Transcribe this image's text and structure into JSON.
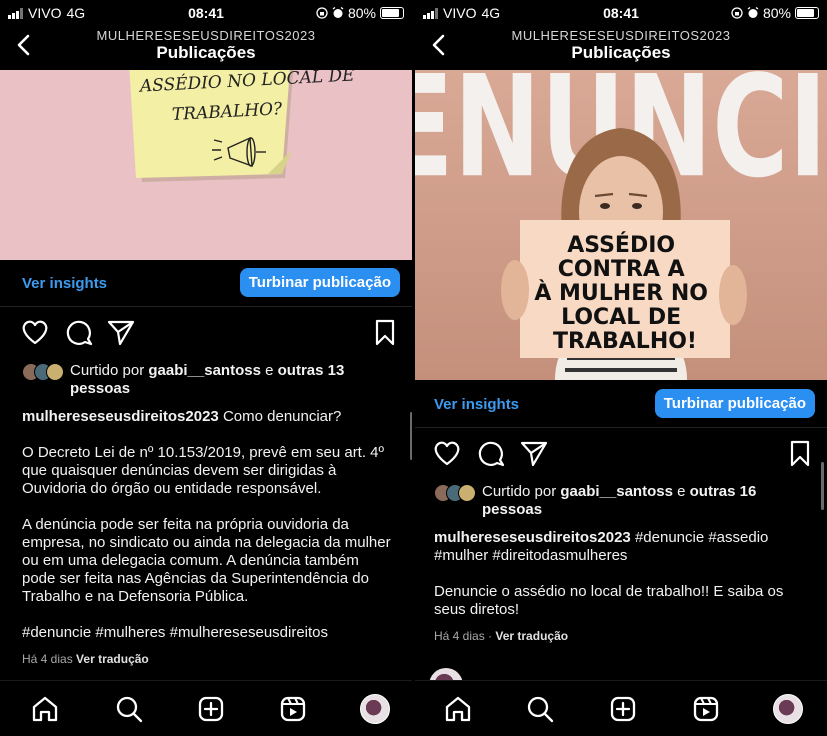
{
  "status_left": {
    "carrier": "VIVO",
    "network": "4G",
    "time": "08:41",
    "battery": "80%"
  },
  "status_right": {
    "carrier": "VIVO",
    "network": "4G",
    "time": "08:41",
    "battery": "80%"
  },
  "header": {
    "account": "MULHERESESEUSDIREITOS2023",
    "title": "Publicações"
  },
  "post_left": {
    "image_text": [
      "ASSÉDIO NO LOCAL DE",
      "TRABALHO?"
    ],
    "insights_label": "Ver insights",
    "boost_label": "Turbinar publicação",
    "likes_prefix": "Curtido por ",
    "likes_user": "gaabi__santoss",
    "likes_and": " e ",
    "likes_others": "outras 13 pessoas",
    "caption_user": "mulhereseseusdireitos2023",
    "caption_text": " Como denunciar?",
    "paragraph_1": "O Decreto Lei de nº 10.153/2019, prevê em seu art. 4º que quaisquer denúncias devem ser dirigidas à Ouvidoria do órgão ou entidade responsável.",
    "paragraph_2": "A denúncia pode ser feita na própria ouvidoria da empresa, no sindicato ou ainda na delegacia da mulher ou em uma delegacia comum. A denúncia também pode ser feita nas Agências da Superintendência do Trabalho e na Defensoria Pública.",
    "hashtags": "#denuncie #mulheres #mulhereseseusdireitos",
    "time_ago": "Há 4 dias",
    "translate": "Ver tradução"
  },
  "post_right": {
    "image_title": "DENUNCIE!",
    "sign_text": [
      "ASSÉDIO",
      "CONTRA A",
      "À MULHER NO",
      "LOCAL DE",
      "TRABALHO!"
    ],
    "insights_label": "Ver insights",
    "boost_label": "Turbinar publicação",
    "likes_prefix": "Curtido por ",
    "likes_user": "gaabi__santoss",
    "likes_and": " e ",
    "likes_others": "outras 16 pessoas",
    "caption_user": "mulhereseseusdireitos2023",
    "caption_text": " #denuncie #assedio #mulher #direitodasmulheres",
    "paragraph_1": "Denuncie o assédio no local de trabalho!! E saiba os seus diretos!",
    "time_ago": "Há 4 dias",
    "separator": " · ",
    "translate": "Ver tradução"
  },
  "icons": {
    "tabs": [
      "home-icon",
      "search-icon",
      "create-icon",
      "reels-icon",
      "profile-avatar"
    ],
    "actions": [
      "heart-icon",
      "comment-icon",
      "share-icon",
      "save-icon"
    ]
  },
  "colors": {
    "accent": "#2a8ff0",
    "link": "#3d9bf0",
    "background": "#000000"
  }
}
